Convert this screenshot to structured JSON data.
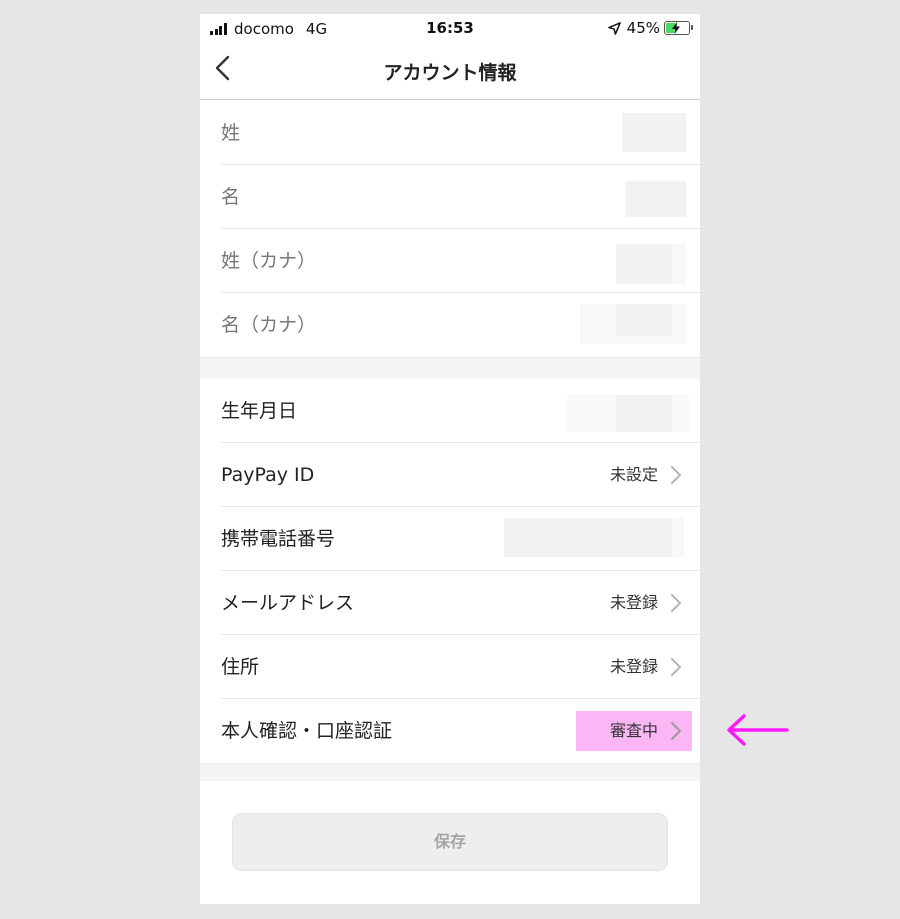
{
  "status_bar": {
    "carrier": "docomo",
    "network": "4G",
    "time": "16:53",
    "battery": "45%",
    "battery_level": 0.45
  },
  "nav": {
    "title": "アカウント情報",
    "back_icon": "chevron-left-icon"
  },
  "name_section": {
    "items": [
      {
        "label": "姓"
      },
      {
        "label": "名"
      },
      {
        "label": "姓（カナ）"
      },
      {
        "label": "名（カナ）"
      }
    ]
  },
  "profile_section": {
    "items": [
      {
        "label": "生年月日",
        "value": ""
      },
      {
        "label": "PayPay ID",
        "value": "未設定"
      },
      {
        "label": "携帯電話番号",
        "value": ""
      },
      {
        "label": "メールアドレス",
        "value": "未登録"
      },
      {
        "label": "住所",
        "value": "未登録"
      },
      {
        "label": "本人確認・口座認証",
        "value": "審査中"
      }
    ]
  },
  "save_label": "保存",
  "colors": {
    "highlight": "#fbb6f5",
    "arrow": "#ff1aff",
    "battery_fill": "#4cd964",
    "background": "#e6e6e6"
  }
}
